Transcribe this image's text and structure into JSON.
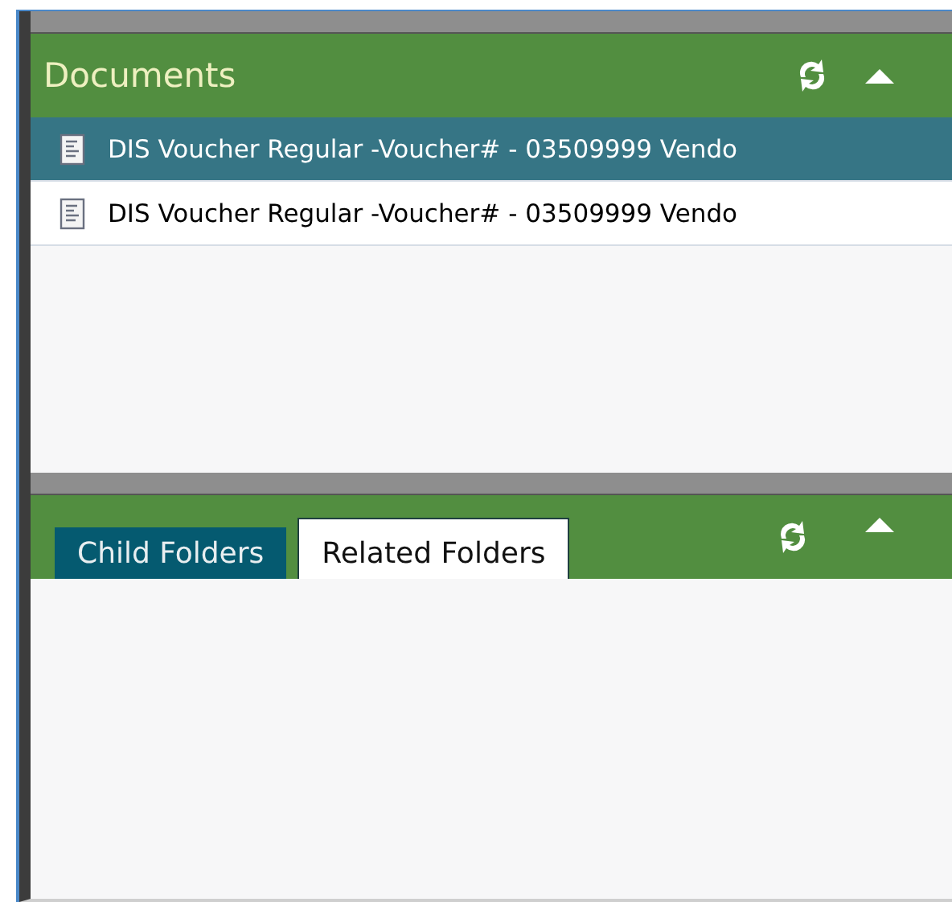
{
  "documents_panel": {
    "title": "Documents",
    "rows": [
      {
        "label": "DIS Voucher Regular -Voucher# - 03509999 Vendo",
        "selected": true
      },
      {
        "label": "DIS Voucher Regular -Voucher# - 03509999 Vendo",
        "selected": false
      }
    ]
  },
  "folders_panel": {
    "tabs": [
      {
        "label": "Child Folders",
        "selected": false
      },
      {
        "label": "Related Folders",
        "selected": true
      }
    ]
  }
}
